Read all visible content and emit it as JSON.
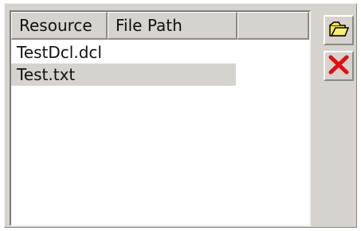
{
  "list": {
    "columns": [
      {
        "label": "Resource"
      },
      {
        "label": "File Path"
      }
    ],
    "rows": [
      {
        "resource": "TestDcl.dcl",
        "file_path": "",
        "selected": false
      },
      {
        "resource": "Test.txt",
        "file_path": "",
        "selected": true
      }
    ]
  },
  "buttons": {
    "open": {
      "icon": "open-folder-icon"
    },
    "remove": {
      "icon": "red-x-delete-icon"
    }
  },
  "colors": {
    "panel_bg": "#d6d3ce",
    "list_bg": "#ffffff",
    "selection": "#d6d3ce",
    "folder_fill": "#f6e84a",
    "delete_red": "#e01010"
  }
}
